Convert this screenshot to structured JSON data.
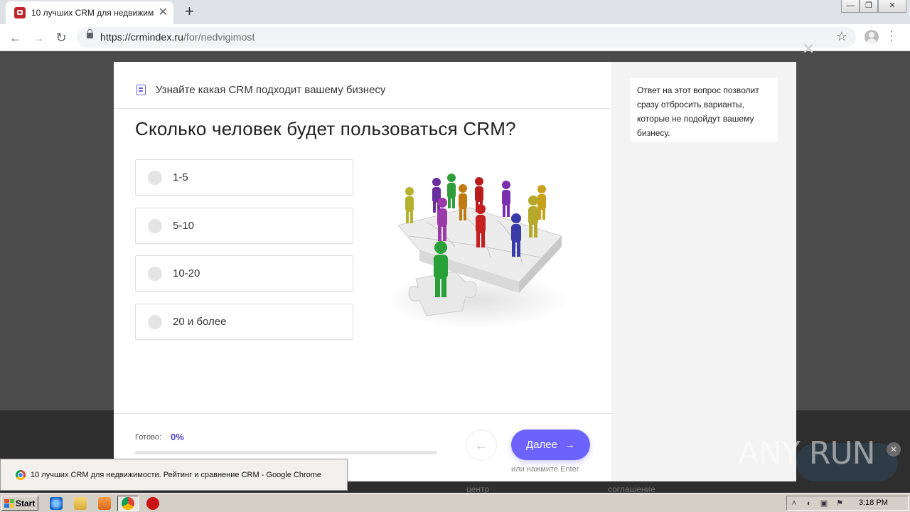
{
  "browser": {
    "tab_title": "10 лучших CRM для недвижимости",
    "tab_close": "✕",
    "new_tab": "+",
    "url_host": "https://crmindex.ru",
    "url_path": "/for/nedvigimost",
    "window_controls": {
      "minimize": "—",
      "maximize": "❐",
      "close": "✕"
    }
  },
  "overlay": {
    "close": "✕"
  },
  "modal": {
    "header_text": "Узнайте какая CRM подходит вашему бизнесу",
    "question": "Сколько человек будет пользоваться CRM?",
    "options": [
      {
        "label": "1-5"
      },
      {
        "label": "5-10"
      },
      {
        "label": "10-20"
      },
      {
        "label": "20 и более"
      }
    ],
    "hint": "Ответ на этот вопрос позволит сразу отбросить варианты, которые не подойдут вашему бизнесу.",
    "progress": {
      "label": "Готово:",
      "value_text": "0%",
      "fraction": 0
    },
    "prev_arrow": "←",
    "next_label": "Далее",
    "next_arrow": "→",
    "enter_hint": "или нажмите Enter"
  },
  "footer_links": [
    "центр",
    "соглашение"
  ],
  "taskbar_popup": "10 лучших CRM для недвижимости. Рейтинг и сравнение CRM - Google Chrome",
  "taskbar": {
    "start_label": "Start",
    "clock": "3:18 PM"
  },
  "watermark": "ANY RUN",
  "colors": {
    "accent": "#6c63ff",
    "progress_value": "#4a44c6",
    "side_panel": "#f3f3f3"
  }
}
